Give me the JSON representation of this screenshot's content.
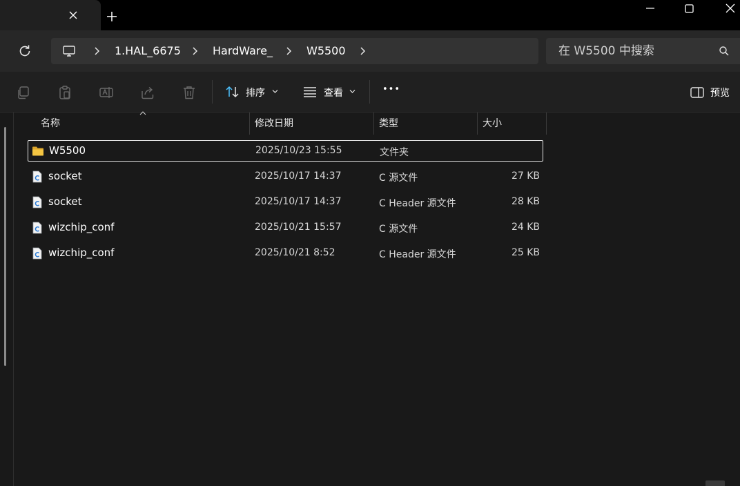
{
  "window": {
    "tab_close_icon": "close-icon",
    "new_tab_icon": "plus-icon",
    "controls": [
      "minimize-icon",
      "maximize-icon",
      "close-icon"
    ]
  },
  "address": {
    "breadcrumbs": [
      "1.HAL_6675",
      "HardWare_",
      "W5500"
    ]
  },
  "search": {
    "placeholder": "在 W5500 中搜索"
  },
  "toolbar": {
    "sort_label": "排序",
    "view_label": "查看",
    "more_label": "•••",
    "preview_label": "预览"
  },
  "columns": {
    "name": "名称",
    "modified": "修改日期",
    "type": "类型",
    "size": "大小"
  },
  "files": [
    {
      "name": "W5500",
      "modified": "2025/10/23 15:55",
      "type": "文件夹",
      "size": "",
      "icon": "folder-icon"
    },
    {
      "name": "socket",
      "modified": "2025/10/17 14:37",
      "type": "C 源文件",
      "size": "27 KB",
      "icon": "c-file-icon"
    },
    {
      "name": "socket",
      "modified": "2025/10/17 14:37",
      "type": "C Header 源文件",
      "size": "28 KB",
      "icon": "c-file-icon"
    },
    {
      "name": "wizchip_conf",
      "modified": "2025/10/21 15:57",
      "type": "C 源文件",
      "size": "24 KB",
      "icon": "c-file-icon"
    },
    {
      "name": "wizchip_conf",
      "modified": "2025/10/21 8:52",
      "type": "C Header 源文件",
      "size": "25 KB",
      "icon": "c-file-icon"
    }
  ],
  "colors": {
    "background": "#191919",
    "titlebar": "#000000",
    "addressbar": "#272727",
    "accent": "#4cc2ff",
    "folder": "#f4c542"
  }
}
